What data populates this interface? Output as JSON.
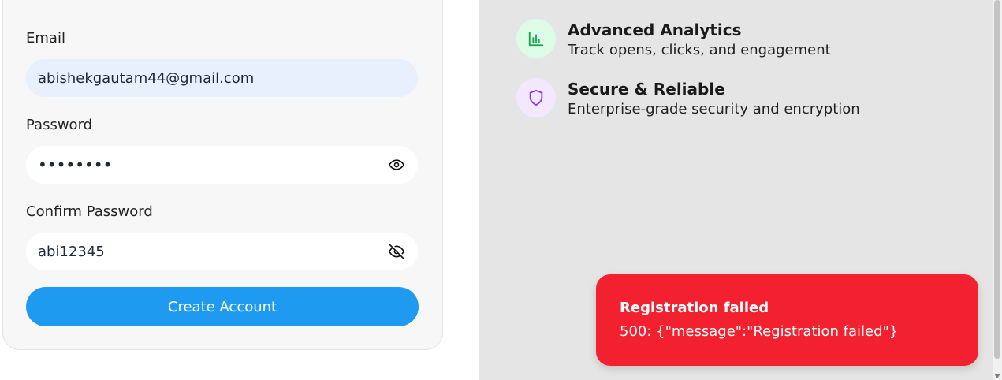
{
  "form": {
    "email": {
      "label": "Email",
      "value": "abishekgautam44@gmail.com"
    },
    "password": {
      "label": "Password",
      "masked_value": "••••••••"
    },
    "confirm_password": {
      "label": "Confirm Password",
      "value": "abi12345"
    },
    "submit_label": "Create Account"
  },
  "features": [
    {
      "title": "Advanced Analytics",
      "description": "Track opens, clicks, and engagement",
      "icon": "bar-chart-icon",
      "color": "#16a34a",
      "bg": "#dcfce7"
    },
    {
      "title": "Secure & Reliable",
      "description": "Enterprise-grade security and encryption",
      "icon": "shield-icon",
      "color": "#9333ea",
      "bg": "#f3e8ff"
    }
  ],
  "toast": {
    "title": "Registration failed",
    "message": "500: {\"message\":\"Registration failed\"}",
    "color": "#f3212f"
  },
  "colors": {
    "primary": "#1e9bf0",
    "panel": "#e5e5e5"
  }
}
